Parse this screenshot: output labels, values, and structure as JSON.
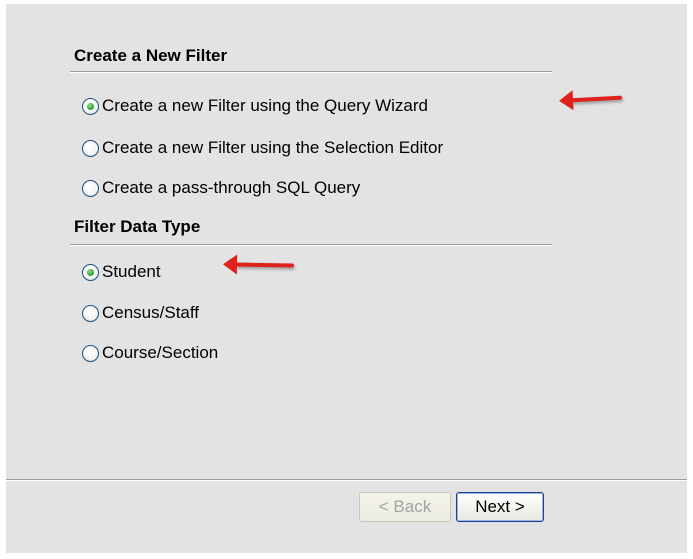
{
  "sections": [
    {
      "title": "Create a New Filter",
      "options": [
        {
          "label": "Create a new Filter using the Query Wizard",
          "checked": true
        },
        {
          "label": "Create a new Filter using the Selection Editor",
          "checked": false
        },
        {
          "label": "Create a pass-through SQL Query",
          "checked": false
        }
      ]
    },
    {
      "title": "Filter Data Type",
      "options": [
        {
          "label": "Student",
          "checked": true
        },
        {
          "label": "Census/Staff",
          "checked": false
        },
        {
          "label": "Course/Section",
          "checked": false
        }
      ]
    }
  ],
  "buttons": {
    "back_label": "< Back",
    "back_enabled": false,
    "next_label": "Next >"
  },
  "annotations": {
    "arrow_color": "#e0201a",
    "arrow_icon": "red-arrow-left-icon"
  },
  "colors": {
    "radio_selected_dot": "#2fa72f",
    "dialog_background": "#e3e3e3"
  }
}
